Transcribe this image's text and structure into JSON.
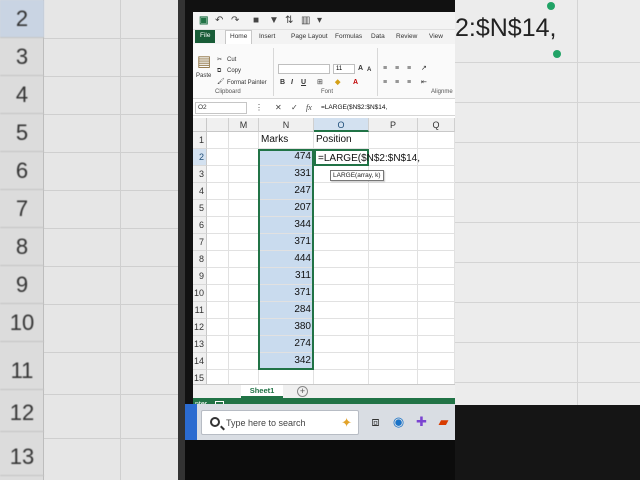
{
  "app": {
    "ribbon_tabs": [
      "File",
      "Home",
      "Insert",
      "Page Layout",
      "Formulas",
      "Data",
      "Review",
      "View"
    ],
    "clipboard": {
      "cut": "Cut",
      "copy": "Copy",
      "paste": "Paste",
      "format_painter": "Format Painter",
      "label": "Clipboard"
    },
    "font_group_label": "Font",
    "alignment_label": "Alignme",
    "font_size": "11"
  },
  "formula_bar": {
    "name_box": "O2",
    "formula": "=LARGE($N$2:$N$14,"
  },
  "grid": {
    "columns": [
      "M",
      "N",
      "O",
      "P",
      "Q"
    ],
    "rows": [
      "1",
      "2",
      "3",
      "4",
      "5",
      "6",
      "7",
      "8",
      "9",
      "10",
      "11",
      "12",
      "13",
      "14",
      "15"
    ],
    "header_marks": "Marks",
    "header_position": "Position",
    "marks": [
      "474",
      "331",
      "247",
      "207",
      "344",
      "371",
      "444",
      "311",
      "371",
      "284",
      "380",
      "274",
      "342"
    ],
    "edit_cell_text": "=LARGE($N$2:$N$14,",
    "tooltip": "LARGE(array, k)"
  },
  "sheets": {
    "active": "Sheet1",
    "add_label": "+"
  },
  "status": {
    "mode": "nter"
  },
  "taskbar": {
    "search_placeholder": "Type here to search"
  },
  "background": {
    "left_rownums": [
      "2",
      "3",
      "4",
      "5",
      "6",
      "7",
      "8",
      "9",
      "10",
      "11",
      "12",
      "13"
    ],
    "right_text": "2:$N$14,"
  },
  "colors": {
    "excel_green": "#217346",
    "selection_blue": "#c9dbee"
  }
}
